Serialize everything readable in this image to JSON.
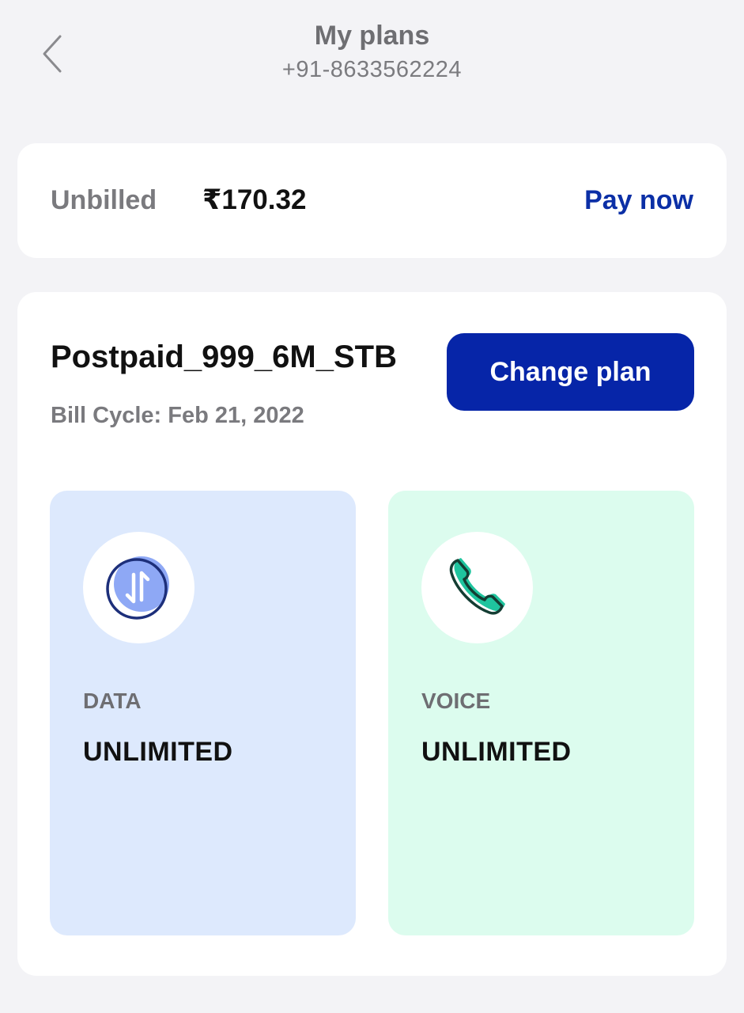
{
  "header": {
    "title": "My plans",
    "phone": "+91-8633562224"
  },
  "bill": {
    "label": "Unbilled",
    "amount": "₹170.32",
    "pay_label": "Pay now"
  },
  "plan": {
    "name": "Postpaid_999_6M_STB",
    "bill_cycle": "Bill Cycle: Feb 21, 2022",
    "change_label": "Change plan"
  },
  "benefits": [
    {
      "icon": "data-transfer-icon",
      "label": "DATA",
      "value": "UNLIMITED"
    },
    {
      "icon": "phone-icon",
      "label": "VOICE",
      "value": "UNLIMITED"
    }
  ],
  "colors": {
    "accent": "#0625a8",
    "link": "#0b2fa6",
    "data_tile": "#dde9fd",
    "voice_tile": "#dcfcee",
    "background": "#f3f3f6"
  }
}
